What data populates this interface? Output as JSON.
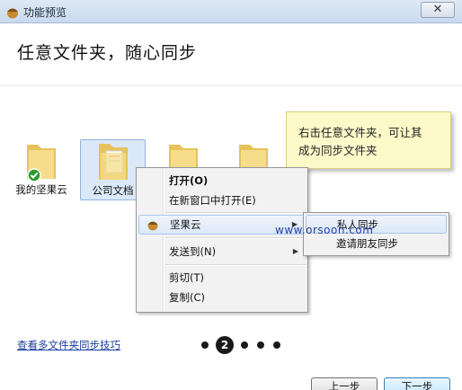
{
  "window": {
    "title": "功能预览",
    "close_glyph": "✕"
  },
  "heading": "任意文件夹，随心同步",
  "tooltip": {
    "line1": "右击任意文件夹，可让其",
    "line2": "成为同步文件夹"
  },
  "folders": [
    {
      "label": "我的坚果云",
      "icon": "folder-synced-icon"
    },
    {
      "label": "公司文档",
      "icon": "folder-document-icon"
    },
    {
      "label": "",
      "icon": "folder-icon"
    },
    {
      "label": "",
      "icon": "folder-icon"
    }
  ],
  "context_menu": {
    "open": "打开(O)",
    "open_new_window": "在新窗口中打开(E)",
    "jianguoyun": "坚果云",
    "send_to": "发送到(N)",
    "cut": "剪切(T)",
    "copy": "复制(C)",
    "submenu_arrow": "▶"
  },
  "submenu": {
    "private_sync": "私人同步",
    "invite_sync": "邀请朋友同步"
  },
  "watermark": "www.orsoon.com",
  "footer": {
    "tips_link": "查看多文件夹同步技巧",
    "current_page": "2",
    "prev_button": "上一步",
    "next_button": "下一步"
  },
  "colors": {
    "accent": "#1a3f9c",
    "tooltip_bg": "#fdf9c9",
    "sync_badge": "#2e9b2e"
  }
}
